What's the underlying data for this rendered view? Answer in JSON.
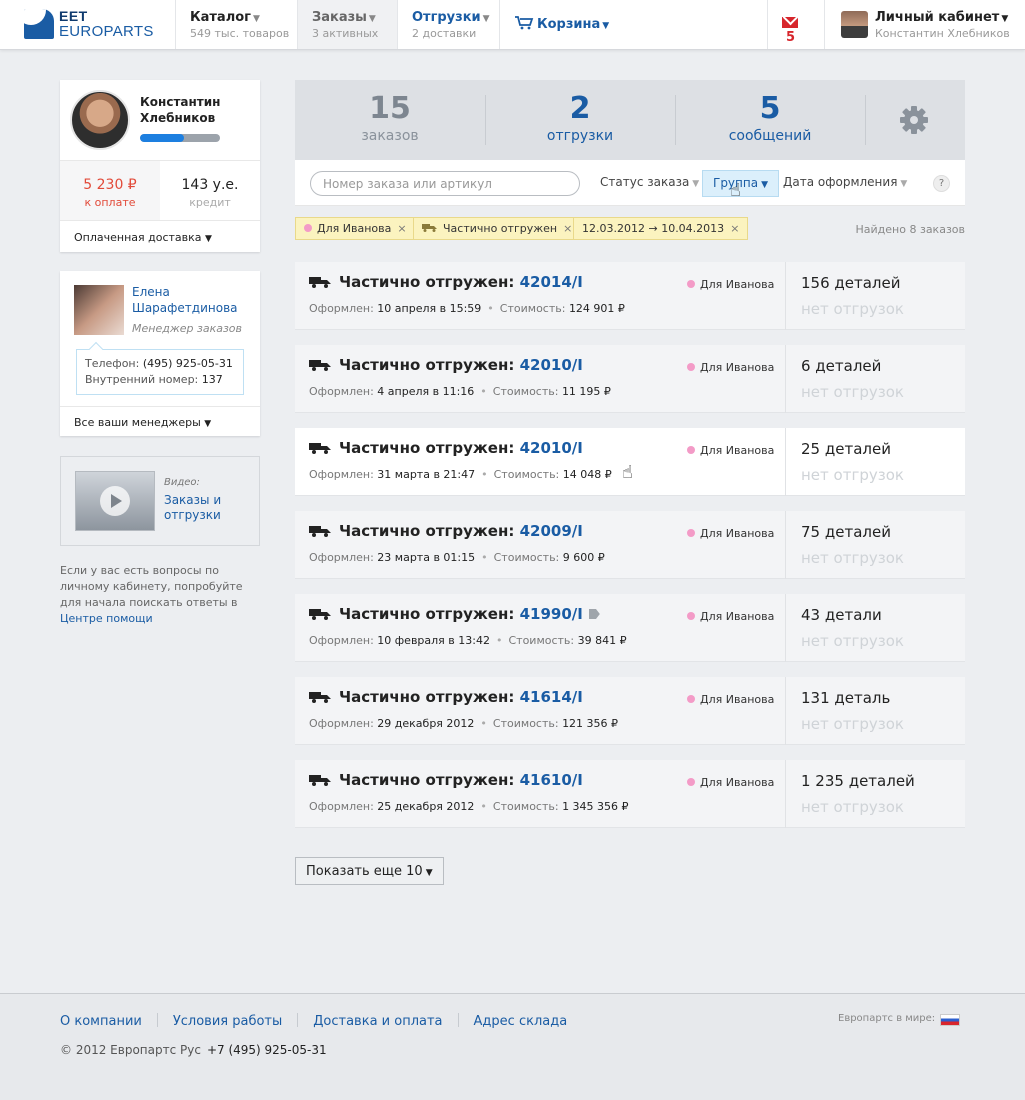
{
  "logo": {
    "line1": "EET",
    "line2": "EUROPARTS"
  },
  "nav": {
    "catalog": {
      "title": "Каталог",
      "sub": "549 тыс. товаров"
    },
    "orders": {
      "title": "Заказы",
      "sub": "3 активных"
    },
    "shipments": {
      "title": "Отгрузки",
      "sub": "2 доставки"
    },
    "cart": {
      "title": "Корзина"
    },
    "mail": {
      "count": "5"
    },
    "profile": {
      "title": "Личный кабинет",
      "sub": "Константин Хлебников"
    }
  },
  "user": {
    "name": "Константин Хлебников",
    "progress": 0.55,
    "to_pay_value": "5 230 ₽",
    "to_pay_label": "к оплате",
    "credit_value": "143 у.е.",
    "credit_label": "кредит",
    "delivery": "Оплаченная доставка"
  },
  "manager": {
    "name": "Елена Шарафетдинова",
    "role": "Менеджер заказов",
    "phone_label": "Телефон:",
    "phone": "(495) 925-05-31",
    "ext_label": "Внутренний номер:",
    "ext": "137",
    "all": "Все ваши менеджеры"
  },
  "video": {
    "label": "Видео:",
    "title": "Заказы и отгрузки"
  },
  "help": {
    "text": "Если у вас есть вопросы по личному кабинету, попробуйте для начала поискать ответы в",
    "link": "Центре помощи"
  },
  "stats": {
    "orders": {
      "n": "15",
      "label": "заказов"
    },
    "shipments": {
      "n": "2",
      "label": "отгрузки"
    },
    "messages": {
      "n": "5",
      "label": "сообщений"
    }
  },
  "filters": {
    "search_placeholder": "Номер заказа или артикул",
    "status": "Статус заказа",
    "group": "Группа",
    "date": "Дата оформления",
    "help": "?"
  },
  "tags": [
    {
      "label": "Для Иванова"
    },
    {
      "label": "Частично отгружен"
    },
    {
      "label": "12.03.2012 → 10.04.2013"
    }
  ],
  "found": "Найдено 8 заказов",
  "order_labels": {
    "created": "Оформлен:",
    "cost": "Стоимость:",
    "status": "Частично отгружен:",
    "group": "Для Иванова",
    "no_ship": "нет отгрузок"
  },
  "orders": [
    {
      "number": "42014/I",
      "date": "10 апреля в 15:59",
      "cost": "124 901 ₽",
      "parts": "156 деталей"
    },
    {
      "number": "42010/I",
      "date": "4 апреля в 11:16",
      "cost": "11 195 ₽",
      "parts": "6 деталей"
    },
    {
      "number": "42010/I",
      "date": "31 марта в 21:47",
      "cost": "14 048 ₽",
      "parts": "25 деталей"
    },
    {
      "number": "42009/I",
      "date": "23 марта в 01:15",
      "cost": "9 600 ₽",
      "parts": "75 деталей"
    },
    {
      "number": "41990/I",
      "date": "10 февраля в 13:42",
      "cost": "39 841 ₽",
      "parts": "43 детали"
    },
    {
      "number": "41614/I",
      "date": "29 декабря 2012",
      "cost": "121 356 ₽",
      "parts": "131 деталь"
    },
    {
      "number": "41610/I",
      "date": "25 декабря 2012",
      "cost": "1 345 356 ₽",
      "parts": "1 235 деталей"
    }
  ],
  "more": "Показать еще 10",
  "footer": {
    "links": [
      "О компании",
      "Условия работы",
      "Доставка и оплата",
      "Адрес склада"
    ],
    "copyright": "© 2012 Европартс Рус",
    "phone": "+7 (495) 925-05-31",
    "world": "Европартс в мире:"
  }
}
